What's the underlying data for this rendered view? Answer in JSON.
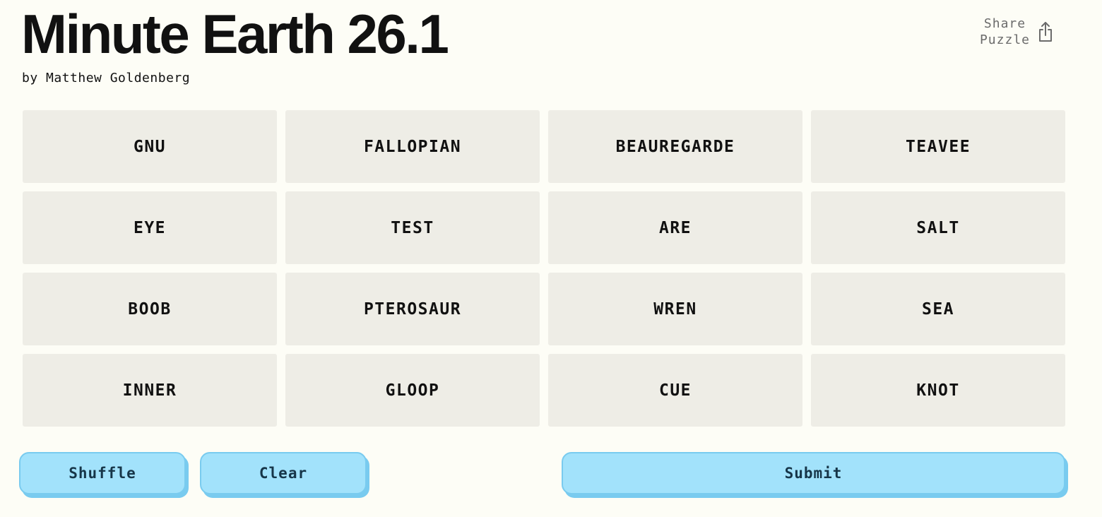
{
  "header": {
    "title": "Minute Earth 26.1",
    "byline": "by Matthew Goldenberg",
    "share_line1": "Share",
    "share_line2": "Puzzle",
    "share_icon": "share-icon"
  },
  "tiles": [
    "GNU",
    "FALLOPIAN",
    "BEAUREGARDE",
    "TEAVEE",
    "EYE",
    "TEST",
    "ARE",
    "SALT",
    "BOOB",
    "PTEROSAUR",
    "WREN",
    "SEA",
    "INNER",
    "GLOOP",
    "CUE",
    "KNOT"
  ],
  "actions": {
    "shuffle": "Shuffle",
    "clear": "Clear",
    "submit": "Submit"
  },
  "colors": {
    "background": "#fdfdf6",
    "tile": "#eeede6",
    "button": "#a2e2fb",
    "button_border": "#79cbef",
    "button_text": "#163548"
  }
}
